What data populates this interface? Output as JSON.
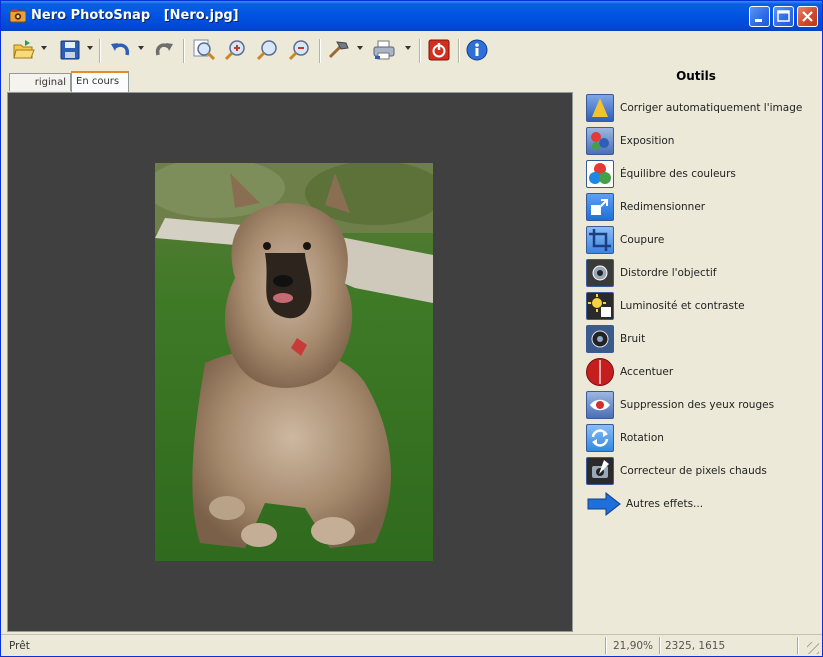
{
  "window": {
    "app_name": "Nero PhotoSnap",
    "file_name": "[Nero.jpg]",
    "title": "Nero PhotoSnap   [Nero.jpg]"
  },
  "toolbar": {
    "buttons": [
      {
        "name": "open-icon"
      },
      {
        "name": "save-icon"
      },
      {
        "name": "undo-icon"
      },
      {
        "name": "redo-icon"
      },
      {
        "name": "zoom-fit-icon"
      },
      {
        "name": "zoom-in-icon"
      },
      {
        "name": "zoom-actual-icon"
      },
      {
        "name": "zoom-out-icon"
      },
      {
        "name": "tools-icon"
      },
      {
        "name": "print-icon"
      },
      {
        "name": "exit-icon"
      },
      {
        "name": "info-icon"
      }
    ]
  },
  "tabs": [
    {
      "label": "Original",
      "display": "riginal"
    },
    {
      "label": "En cours",
      "active": true
    }
  ],
  "tools": {
    "title": "Outils",
    "items": [
      {
        "label": "Corriger automatiquement l'image",
        "icon": "auto-correct-icon",
        "color": "#2E5FB8"
      },
      {
        "label": "Exposition",
        "icon": "exposure-icon",
        "color": "#4A6FB5"
      },
      {
        "label": "Équilibre des couleurs",
        "icon": "color-balance-icon",
        "color": "#FFFFFF"
      },
      {
        "label": "Redimensionner",
        "icon": "resize-icon",
        "color": "#1E6FD9"
      },
      {
        "label": "Coupure",
        "icon": "crop-icon",
        "color": "#3C84E0"
      },
      {
        "label": "Distordre l'objectif",
        "icon": "lens-distort-icon",
        "color": "#3A3A3A"
      },
      {
        "label": "Luminosité et contraste",
        "icon": "brightness-contrast-icon",
        "color": "#2A2A2A"
      },
      {
        "label": "Bruit",
        "icon": "noise-icon",
        "color": "#3A5A8A"
      },
      {
        "label": "Accentuer",
        "icon": "sharpen-icon",
        "color": "#C41E1E"
      },
      {
        "label": "Suppression des yeux rouges",
        "icon": "red-eye-icon",
        "color": "#4A6FB5"
      },
      {
        "label": "Rotation",
        "icon": "rotate-icon",
        "color": "#2E8AE0"
      },
      {
        "label": "Correcteur de pixels chauds",
        "icon": "hot-pixel-icon",
        "color": "#2A2A2A"
      }
    ],
    "more_effects": "Autres effets..."
  },
  "status": {
    "left": "Prêt",
    "zoom": "21,90%",
    "dimensions": "2325, 1615"
  },
  "colors": {
    "title_bar": "#0054E3",
    "canvas_bg": "#404040",
    "window_bg": "#ECE9D8"
  }
}
